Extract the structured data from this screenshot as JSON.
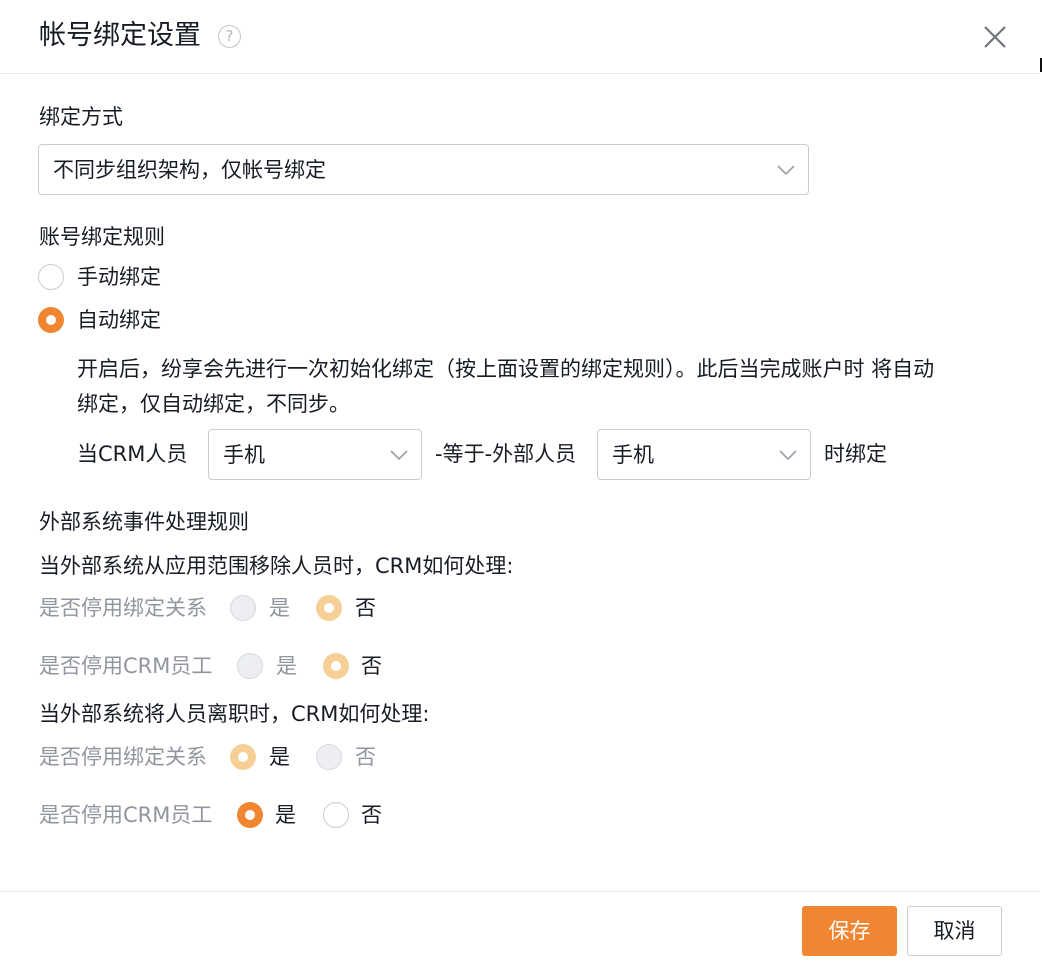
{
  "dialog": {
    "title": "帐号绑定设置",
    "help_icon": "?",
    "close_icon": "close-icon"
  },
  "binding_method": {
    "label": "绑定方式",
    "selected": "不同步组织架构，仅帐号绑定"
  },
  "binding_rule": {
    "label": "账号绑定规则",
    "manual_label": "手动绑定",
    "auto_label": "自动绑定",
    "selected": "auto",
    "description_line1": "开启后，纷享会先进行一次初始化绑定（按上面设置的绑定规则）。此后当完成账户时 将自动",
    "description_line2": "绑定，仅自动绑定，不同步。",
    "rule_prefix": "当CRM人员",
    "crm_field": "手机",
    "rule_middle": "-等于-外部人员",
    "external_field": "手机",
    "rule_suffix": "时绑定"
  },
  "event_rules": {
    "label": "外部系统事件处理规则",
    "remove_scope": {
      "question": "当外部系统从应用范围移除人员时，CRM如何处理:",
      "disable_binding": {
        "label": "是否停用绑定关系",
        "yes": "是",
        "no": "否",
        "value": "否",
        "disabled": true
      },
      "disable_employee": {
        "label": "是否停用CRM员工",
        "yes": "是",
        "no": "否",
        "value": "否",
        "disabled": true
      }
    },
    "resign": {
      "question": "当外部系统将人员离职时，CRM如何处理:",
      "disable_binding": {
        "label": "是否停用绑定关系",
        "yes": "是",
        "no": "否",
        "value": "是",
        "disabled": true
      },
      "disable_employee": {
        "label": "是否停用CRM员工",
        "yes": "是",
        "no": "否",
        "value": "是",
        "disabled": false
      }
    }
  },
  "footer": {
    "save_label": "保存",
    "cancel_label": "取消"
  },
  "colors": {
    "accent": "#f08532",
    "accent_disabled": "#f5cf96",
    "border": "#c9cdd4",
    "text": "#181c25",
    "muted": "#91959e"
  }
}
